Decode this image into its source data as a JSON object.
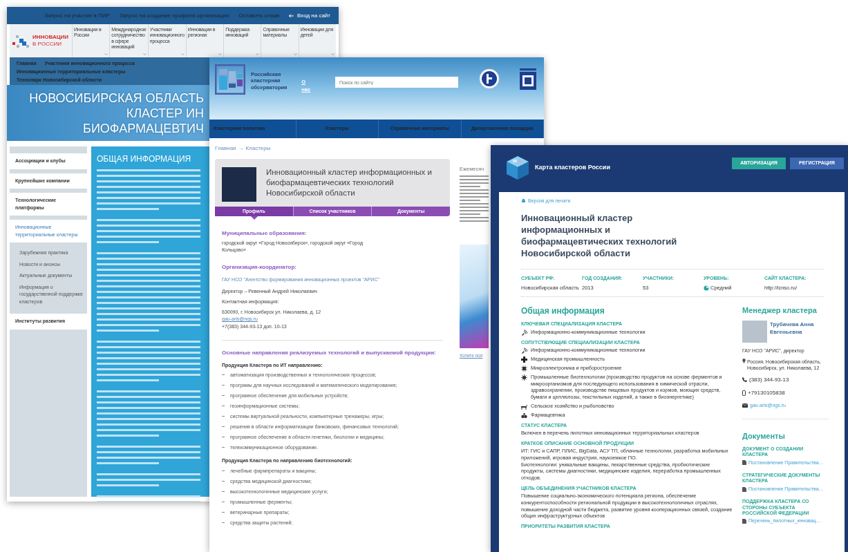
{
  "innovations_site": {
    "top_links": [
      "Запрос на участие в ПИР",
      "Запрос на создание профиля организации",
      "Оставить отзыв"
    ],
    "login_link": "Вход на сайт",
    "logo": {
      "line1": "ИННОВАЦИИ",
      "line2": "В РОССИИ"
    },
    "menu": [
      "Инновации в России",
      "Международное сотрудничество в сфере инноваций",
      "Участники инновационного процесса",
      "Инновации в регионах",
      "Поддержка инноваций",
      "Справочные материалы",
      "Инновации для детей"
    ],
    "breadcrumbs": [
      "Главная",
      "Участники инновационного процесса",
      "Инновационные территориальные кластеры",
      "Технопарк Новосибирской области"
    ],
    "hero_lines": [
      "НОВОСИБИРСКАЯ ОБЛАСТЬ",
      "КЛАСТЕР ИН",
      "БИОФАРМАЦЕВТИЧ"
    ],
    "sidebar": [
      {
        "label": "Ассоциации и клубы",
        "selected": false
      },
      {
        "label": "Крупнейшие компании",
        "selected": false
      },
      {
        "label": "Технологические платформы",
        "selected": false
      },
      {
        "label": "Инновационные территориальные кластеры",
        "selected": true,
        "children": [
          {
            "label": "Зарубежная практика",
            "selected": false
          },
          {
            "label": "Новости и анонсы",
            "selected": false
          },
          {
            "label": "Актуальные документы",
            "selected": false
          },
          {
            "label": "Информация о государственной поддержке кластеров",
            "selected": false
          }
        ]
      },
      {
        "label": "Институты развития",
        "selected": false
      }
    ],
    "panel_title": "ОБЩАЯ ИНФОРМАЦИЯ"
  },
  "observatory_site": {
    "logo_text": "Российская кластерная обсерватория",
    "about_link": "О нас",
    "search": {
      "placeholder": "Поиск по сайту"
    },
    "nav": [
      "Кластерная политика",
      "Кластеры",
      "Справочные материалы",
      "Дискуссионная площадка"
    ],
    "breadcrumbs": [
      "Главная",
      "Кластеры"
    ],
    "breadcrumb_separator": "→",
    "card_title": "Инновационный кластер информационных и биофармацевтических технологий Новосибирской области",
    "tabs": [
      {
        "label": "Профиль",
        "selected": true
      },
      {
        "label": "Список участников",
        "selected": false
      },
      {
        "label": "Документы",
        "selected": false
      }
    ],
    "municipal": {
      "heading": "Муниципальные образования:",
      "text": "городской округ «Город Новосибирск», городской округ «Город Кольцово»"
    },
    "coordinator": {
      "heading": "Организация-координатор:",
      "org_link": "ГАУ НСО \"Агентство формирования инновационных проектов \"АРИС\"",
      "director": "Директор – Ревенный Андрей Николаевич",
      "contacts_label": "Контактная информация:",
      "address": "630090, г. Новосибирск ул. Николаева, д. 12",
      "email": "gau-aris@ngs.ru",
      "phone": "+7(383) 344-93-13 доп. 10-13"
    },
    "products": {
      "heading": "Основные направления реализуемых технологий и выпускаемой продукции:",
      "groups": [
        {
          "title": "Продукция Кластера по ИТ направлению:",
          "items": [
            "автоматизация производственных и технологических процессов;",
            "програмы для научных исследований и математического моделирования;",
            "програмное обеспечение для мобильных устройств;",
            "геоинформационные системы;",
            "системы виртуальной реальности, компьютерные тренажеры, игры;",
            "решения в области информатизации банковских, финансовых технологий;",
            "програмное обеспечение в области генетики, биологии и медицины;",
            "телекоммуникационное оборудование."
          ]
        },
        {
          "title": "Продукция Кластера по направлению биотехнологий:",
          "items": [
            "лечебные фармпрепараты и вакцины;",
            "средства медицинской диагностики;",
            "высокотехнологичные медицинские услуги;",
            "промышленные ферменты;",
            "ветеринарные препараты;",
            "средства защиты растений;"
          ]
        }
      ]
    },
    "side": {
      "heading": "Ежемесяч",
      "link": "Хотите пол"
    }
  },
  "cluster_map_site": {
    "site_title": "Карта кластеров России",
    "buttons": [
      {
        "label": "АВТОРИЗАЦИЯ",
        "kind": "login"
      },
      {
        "label": "РЕГИСТРАЦИЯ",
        "kind": "register"
      }
    ],
    "print_link": "Версия для печати",
    "cluster_title": "Инновационный кластер информационных и биофармацевтических технологий Новосибирской области",
    "stats": [
      {
        "label": "СУБЪЕКТ РФ:",
        "value": "Новосибирская область",
        "kind": "text"
      },
      {
        "label": "ГОД СОЗДАНИЯ:",
        "value": "2013",
        "kind": "text"
      },
      {
        "label": "УЧАСТНИКИ:",
        "value": "53",
        "kind": "text"
      },
      {
        "label": "УРОВЕНЬ:",
        "value": "Средний",
        "kind": "level"
      },
      {
        "label": "САЙТ КЛАСТЕРА:",
        "value": "http://icnso.ru/",
        "kind": "link"
      }
    ],
    "general": {
      "heading": "Общая информация",
      "specializations": [
        {
          "title": "КЛЮЧЕВАЯ СПЕЦИАЛИЗАЦИЯ КЛАСТЕРА",
          "items": [
            {
              "label": "Информационно-коммуникационные технологии",
              "kind": "ict"
            }
          ]
        },
        {
          "title": "СОПУТСТВУЮЩИЕ СПЕЦИАЛИЗАЦИИ КЛАСТЕРА",
          "items": [
            {
              "label": "Информационно-коммуникационные технологии",
              "kind": "ict"
            },
            {
              "label": "Медицинская промышленность",
              "kind": "medical"
            },
            {
              "label": "Микроэлектроника и приборостроение",
              "kind": "electronics"
            },
            {
              "label": "Промышленные биотехнологии (производство продуктов на основе ферментов и микроорганизмов для последующего использования в химической отрасли, здравоохранении, производстве пищевых продуктов и кормов, моющих средств, бумаги и целлюлозы, текстильных изделий, а также в биоэнергетике)",
              "kind": "biotech"
            },
            {
              "label": "Сельское хозяйство и рыболовство",
              "kind": "agriculture"
            },
            {
              "label": "Фармацевтика",
              "kind": "pharma"
            }
          ]
        }
      ],
      "sections": [
        {
          "title": "СТАТУС КЛАСТЕРА",
          "paragraphs": [
            "Включен в перечень пилотных инновационных территориальных кластеров"
          ]
        },
        {
          "title": "КРАТКОЕ ОПИСАНИЕ ОСНОВНОЙ ПРОДУКЦИИ",
          "paragraphs": [
            "ИТ: ГИС и САПР, ПЛИС, BigData, АСУ ТП, облачные технологии, разработка мобильных приложений, игровая индустрия, наукоемкое ПО.",
            "Биотехнологии: уникальные вакцины, лекарственные средства, пробиотические продукты, системы диагностики, медицинские изделия, переработка промышленных отходов."
          ]
        },
        {
          "title": "ЦЕЛЬ ОБЪЕДИНЕНИЯ УЧАСТНИКОВ КЛАСТЕРА",
          "paragraphs": [
            "Повышение социально-экономического потенциала региона, обеспечение конкурентоспособности региональной продукции в высокотехнологичных отраслях, повышение доходной части бюджета, развитие уровня кооперационных связей, создание общих инфраструктурных объектов"
          ]
        },
        {
          "title": "ПРИОРИТЕТЫ РАЗВИТИЯ КЛАСТЕРА"
        }
      ]
    },
    "manager": {
      "heading": "Менеджер кластера",
      "name": "Трубачева Анна Евгеньевна",
      "org": "ГАУ НСО \"АРИС\", директор",
      "address": "Россия, Новосибирская область, Новосибирск, ул. Николаева, 12",
      "phone": "(383) 344-93-13",
      "mobile": "+79130105838",
      "email": "gau-aris@ngs.ru"
    },
    "documents": {
      "heading": "Документы",
      "groups": [
        {
          "title": "ДОКУМЕНТ О СОЗДАНИИ КЛАСТЕРА",
          "link": "Постановление Правительства…"
        },
        {
          "title": "СТРАТЕГИЧЕСКИЕ ДОКУМЕНТЫ КЛАСТЕРА",
          "link": "Постановление Правительства…"
        },
        {
          "title": "ПОДДЕРЖКА КЛАСТЕРА СО СТОРОНЫ СУБЪЕКТА РОССИЙСКОЙ ФЕДЕРАЦИИ",
          "link": "Перечень_пилотных_инновац…"
        }
      ]
    }
  }
}
